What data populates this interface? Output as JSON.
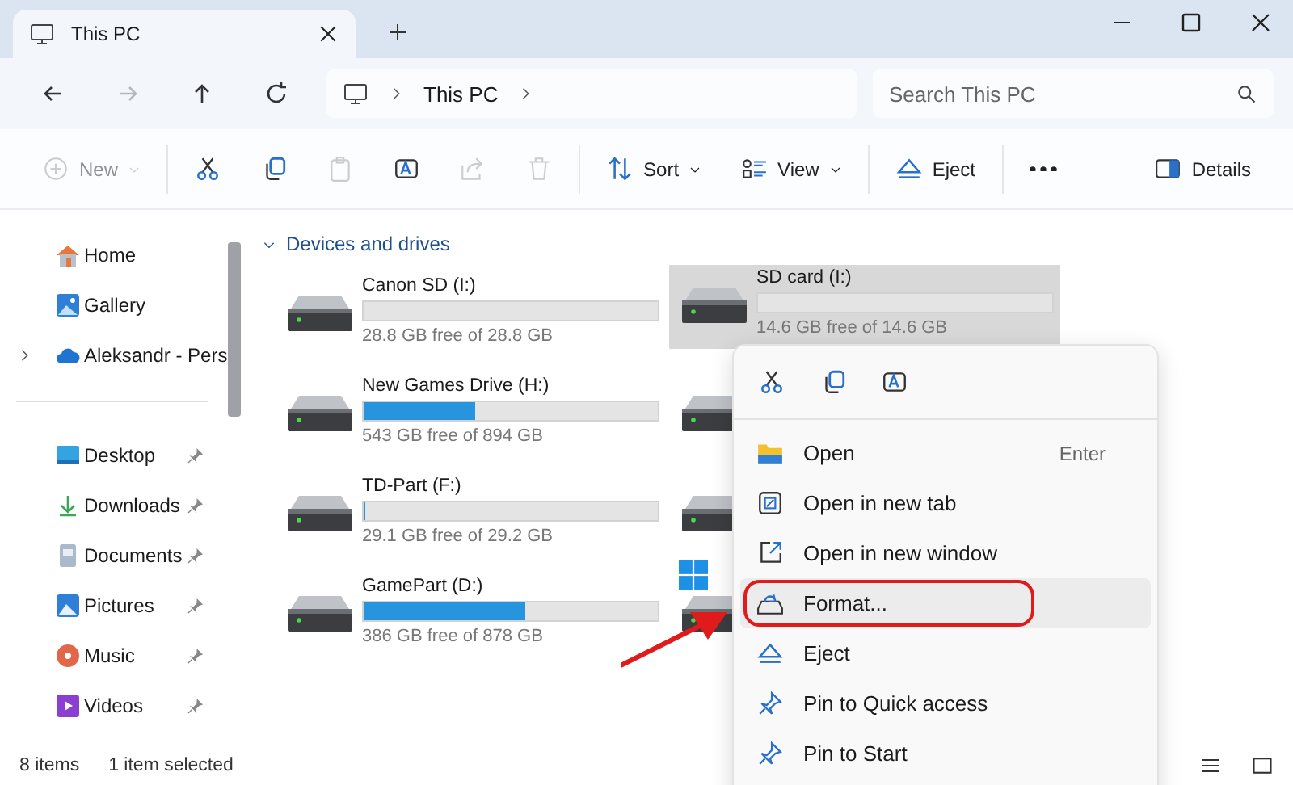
{
  "window": {
    "tab": {
      "title": "This PC"
    }
  },
  "nav": [
    {
      "kind": "back",
      "disabled": false
    },
    {
      "kind": "forward",
      "disabled": true
    },
    {
      "kind": "up",
      "disabled": false
    },
    {
      "kind": "refresh",
      "disabled": false
    }
  ],
  "address": {
    "crumbs": [
      "This PC"
    ]
  },
  "search": {
    "placeholder": "Search This PC"
  },
  "toolbar": {
    "groups": [
      [
        {
          "kind": "new",
          "label": "New",
          "dropdown": true,
          "disabled": true
        }
      ],
      [
        {
          "kind": "cut",
          "disabled": false
        },
        {
          "kind": "copy",
          "disabled": false
        },
        {
          "kind": "paste",
          "disabled": true
        },
        {
          "kind": "rename",
          "disabled": false
        },
        {
          "kind": "share",
          "disabled": true
        },
        {
          "kind": "delete",
          "disabled": true
        }
      ],
      [
        {
          "kind": "sort",
          "label": "Sort",
          "dropdown": true,
          "disabled": false
        },
        {
          "kind": "view",
          "label": "View",
          "dropdown": true,
          "disabled": false
        }
      ],
      [
        {
          "kind": "eject",
          "label": "Eject",
          "dropdown": false,
          "disabled": false
        }
      ],
      [
        {
          "kind": "more",
          "disabled": false
        }
      ]
    ],
    "details": {
      "label": "Details"
    }
  },
  "sidebar": {
    "groups": [
      {
        "items": [
          {
            "kind": "home",
            "label": "Home",
            "pinned": false,
            "expandable": false
          },
          {
            "kind": "gallery",
            "label": "Gallery",
            "pinned": false,
            "expandable": false
          },
          {
            "kind": "cloud",
            "label": "Aleksandr - Pers",
            "pinned": false,
            "expandable": true
          }
        ]
      },
      {
        "items": [
          {
            "kind": "desktop",
            "label": "Desktop",
            "pinned": true,
            "expandable": false
          },
          {
            "kind": "downloads",
            "label": "Downloads",
            "pinned": true,
            "expandable": false
          },
          {
            "kind": "documents",
            "label": "Documents",
            "pinned": true,
            "expandable": false
          },
          {
            "kind": "pictures",
            "label": "Pictures",
            "pinned": true,
            "expandable": false
          },
          {
            "kind": "music",
            "label": "Music",
            "pinned": true,
            "expandable": false
          },
          {
            "kind": "videos",
            "label": "Videos",
            "pinned": true,
            "expandable": false
          }
        ]
      }
    ]
  },
  "section": {
    "title": "Devices and drives",
    "expanded": true
  },
  "drives": [
    {
      "name": "Canon SD (I:)",
      "free": "28.8 GB free of 28.8 GB",
      "selected": false,
      "system": false
    },
    {
      "name": "SD card (I:)",
      "free": "14.6 GB free of 14.6 GB",
      "selected": true,
      "system": false
    },
    {
      "name": "New Games Drive (H:)",
      "free": "543 GB free of 894 GB",
      "level": 0.38,
      "selected": false,
      "system": false
    },
    {
      "selected": false,
      "system": false
    },
    {
      "name": "TD-Part (F:)",
      "free": "29.1 GB free of 29.2 GB",
      "level": 0.003,
      "selected": false,
      "system": false
    },
    {
      "selected": false,
      "system": false
    },
    {
      "name": "GamePart (D:)",
      "free": "386 GB free of 878 GB",
      "level": 0.55,
      "selected": false,
      "system": false
    },
    {
      "selected": false,
      "system": true
    }
  ],
  "status": {
    "count": "8 items",
    "selection": "1 item selected"
  },
  "context_menu": {
    "quick_actions": [
      {
        "kind": "cut"
      },
      {
        "kind": "copy"
      },
      {
        "kind": "rename"
      }
    ],
    "items": [
      {
        "kind": "open",
        "label": "Open",
        "shortcut": "Enter",
        "selected": false,
        "callout": false
      },
      {
        "kind": "newtab",
        "label": "Open in new tab",
        "selected": false,
        "callout": false
      },
      {
        "kind": "newwindow",
        "label": "Open in new window",
        "selected": false,
        "callout": false
      },
      {
        "kind": "format",
        "label": "Format...",
        "selected": true,
        "callout": true
      },
      {
        "kind": "eject",
        "label": "Eject",
        "selected": false,
        "callout": false
      },
      {
        "kind": "pin",
        "label": "Pin to Quick access",
        "selected": false,
        "callout": false
      },
      {
        "kind": "pin",
        "label": "Pin to Start",
        "selected": false,
        "callout": false
      }
    ]
  }
}
